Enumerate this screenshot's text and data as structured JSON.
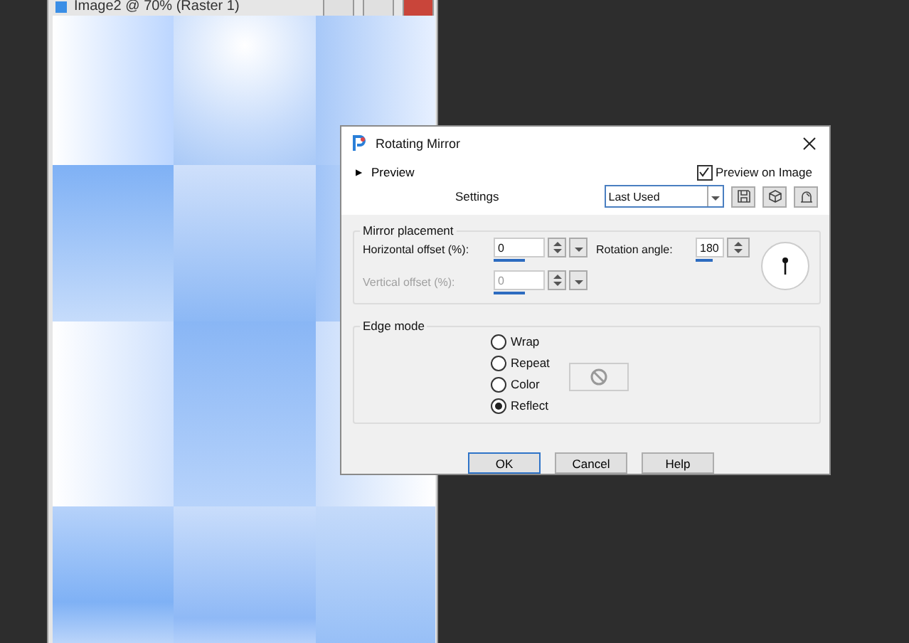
{
  "image_window": {
    "title": "Image2 @ 70% (Raster 1)"
  },
  "dialog": {
    "title": "Rotating Mirror",
    "preview_toggle": {
      "icon": "▶",
      "label": "Preview",
      "expanded": false
    },
    "preview_on_image": {
      "label": "Preview on Image",
      "checked": true
    },
    "settings": {
      "label": "Settings",
      "value": "Last Used"
    },
    "mirror_placement": {
      "title": "Mirror placement",
      "horizontal_offset": {
        "label": "Horizontal offset (%):",
        "value": "0",
        "disabled": false
      },
      "vertical_offset": {
        "label": "Vertical offset (%):",
        "value": "0",
        "disabled": true
      },
      "rotation_angle": {
        "label": "Rotation angle:",
        "value": "180"
      }
    },
    "edge_mode": {
      "title": "Edge mode",
      "options": [
        {
          "label": "Wrap",
          "selected": false
        },
        {
          "label": "Repeat",
          "selected": false
        },
        {
          "label": "Color",
          "selected": false
        },
        {
          "label": "Reflect",
          "selected": true
        }
      ]
    },
    "buttons": [
      "OK",
      "Cancel",
      "Help"
    ]
  }
}
